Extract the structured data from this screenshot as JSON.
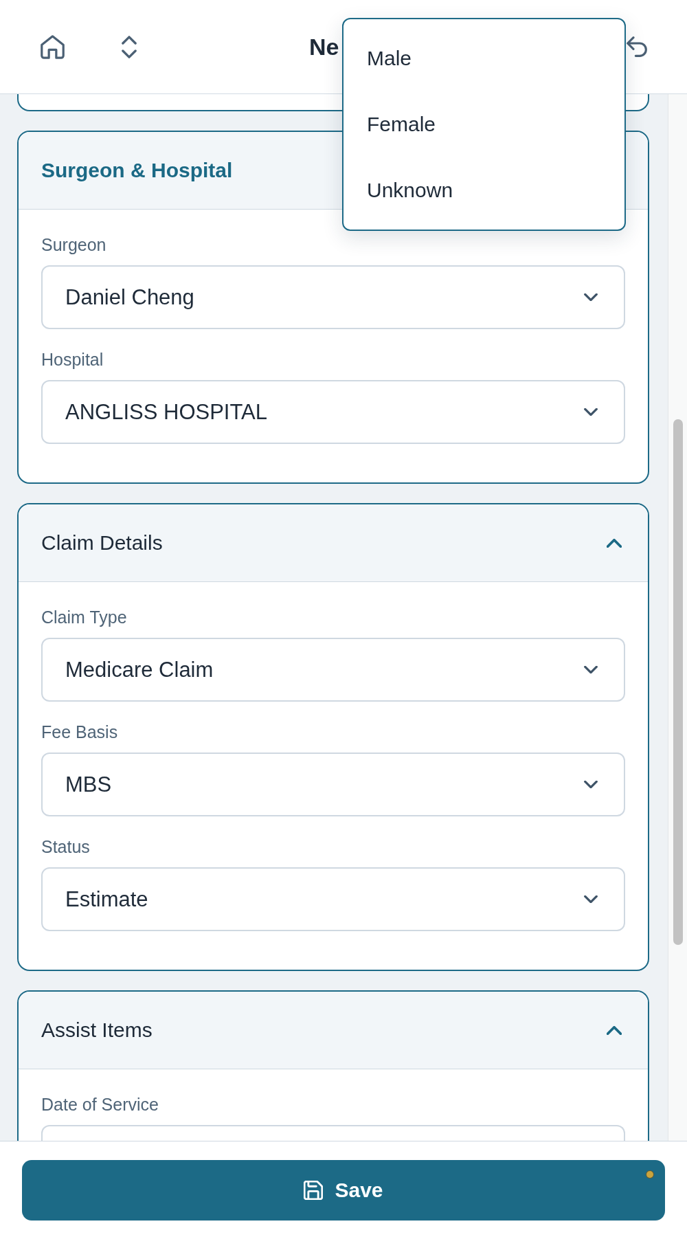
{
  "header": {
    "title": "Ne"
  },
  "dropdown_menu": {
    "options": [
      {
        "label": "Male",
        "selected": false
      },
      {
        "label": "Female",
        "selected": false
      },
      {
        "label": "Unknown",
        "selected": false
      }
    ]
  },
  "sections": [
    {
      "title": "Surgeon & Hospital",
      "highlighted": true,
      "fields": [
        {
          "label": "Surgeon",
          "value": "Daniel Cheng",
          "kind": "select"
        },
        {
          "label": "Hospital",
          "value": "ANGLISS HOSPITAL",
          "kind": "select"
        }
      ]
    },
    {
      "title": "Claim Details",
      "highlighted": false,
      "expanded": true,
      "fields": [
        {
          "label": "Claim Type",
          "value": "Medicare Claim",
          "kind": "select"
        },
        {
          "label": "Fee Basis",
          "value": "MBS",
          "kind": "select"
        },
        {
          "label": "Status",
          "value": "Estimate",
          "kind": "select"
        }
      ]
    },
    {
      "title": "Assist Items",
      "highlighted": false,
      "expanded": true,
      "fields": [
        {
          "label": "Date of Service",
          "kind": "date"
        }
      ]
    }
  ],
  "save_button": {
    "label": "Save",
    "unsaved": true
  }
}
